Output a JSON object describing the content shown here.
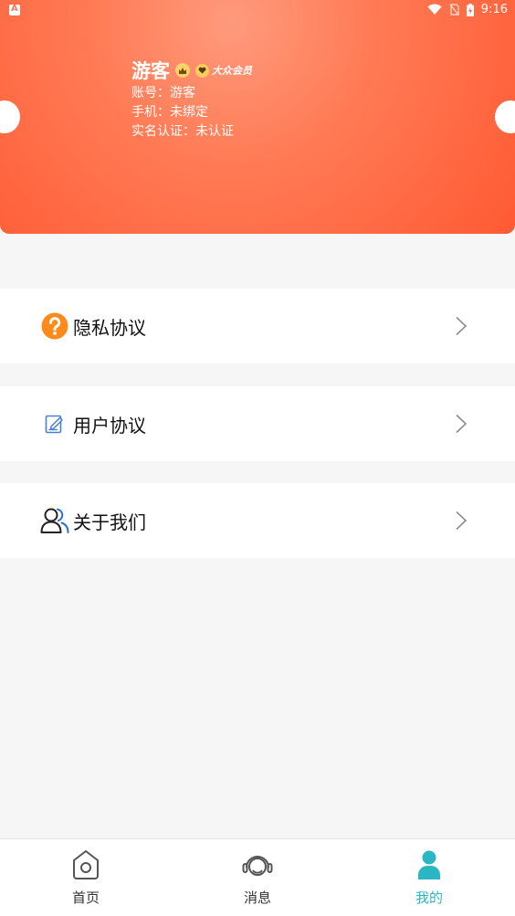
{
  "status_bar": {
    "time": "9:16"
  },
  "profile": {
    "name": "游客",
    "vip_label": "大众会员",
    "account_line": "账号：游客",
    "phone_line": "手机：未绑定",
    "realname_line": "实名认证：未认证"
  },
  "menu": [
    {
      "label": "隐私协议",
      "icon": "question-icon"
    },
    {
      "label": "用户协议",
      "icon": "edit-document-icon"
    },
    {
      "label": "关于我们",
      "icon": "users-icon"
    }
  ],
  "nav": [
    {
      "label": "首页",
      "icon": "home-icon",
      "active": false
    },
    {
      "label": "消息",
      "icon": "headset-icon",
      "active": false
    },
    {
      "label": "我的",
      "icon": "user-icon",
      "active": true
    }
  ],
  "colors": {
    "header_gradient": [
      "#ff9a7c",
      "#ff5a33"
    ],
    "active_nav": "#2bb6c4",
    "question_icon": "#ff8a1a"
  }
}
